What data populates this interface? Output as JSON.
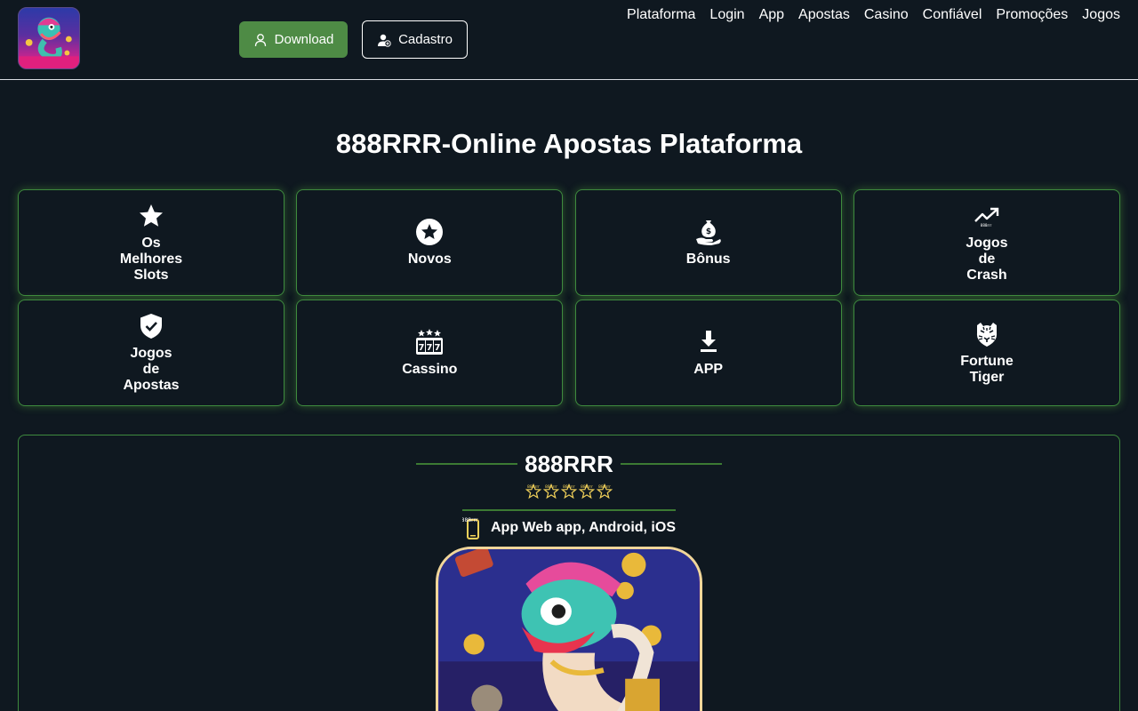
{
  "header": {
    "logo": {
      "icon": "snake-mascot-logo",
      "text": "888rrr"
    },
    "download_label": "Download",
    "cadastro_label": "Cadastro",
    "nav": [
      "Plataforma",
      "Login",
      "App",
      "Apostas",
      "Casino",
      "Confiável",
      "Promoções",
      "Jogos"
    ]
  },
  "main": {
    "title": "888RRR-Online Apostas Plataforma",
    "categories": [
      {
        "label": "Os Melhores Slots",
        "icon": "star-icon"
      },
      {
        "label": "Novos",
        "icon": "star-circle-icon"
      },
      {
        "label": "Bônus",
        "icon": "money-bag-hand-icon"
      },
      {
        "label": "Jogos de Crash",
        "icon": "trending-up-icon"
      },
      {
        "label": "Jogos de Apostas",
        "icon": "shield-check-icon"
      },
      {
        "label": "Cassino",
        "icon": "slot-777-icon"
      },
      {
        "label": "APP",
        "icon": "download-icon"
      },
      {
        "label": "Fortune Tiger",
        "icon": "tiger-icon"
      }
    ]
  },
  "app_section": {
    "name": "888RRR",
    "rating": {
      "stars": 5,
      "filled": 0,
      "icon_text": "888rrr"
    },
    "platforms": "App Web app, Android, iOS",
    "phone_icon_text": "888rrr"
  },
  "colors": {
    "background": "#0f1820",
    "accent_green": "#4e8b45",
    "card_border": "#3e8a3e",
    "star_yellow": "#f3d25a"
  }
}
